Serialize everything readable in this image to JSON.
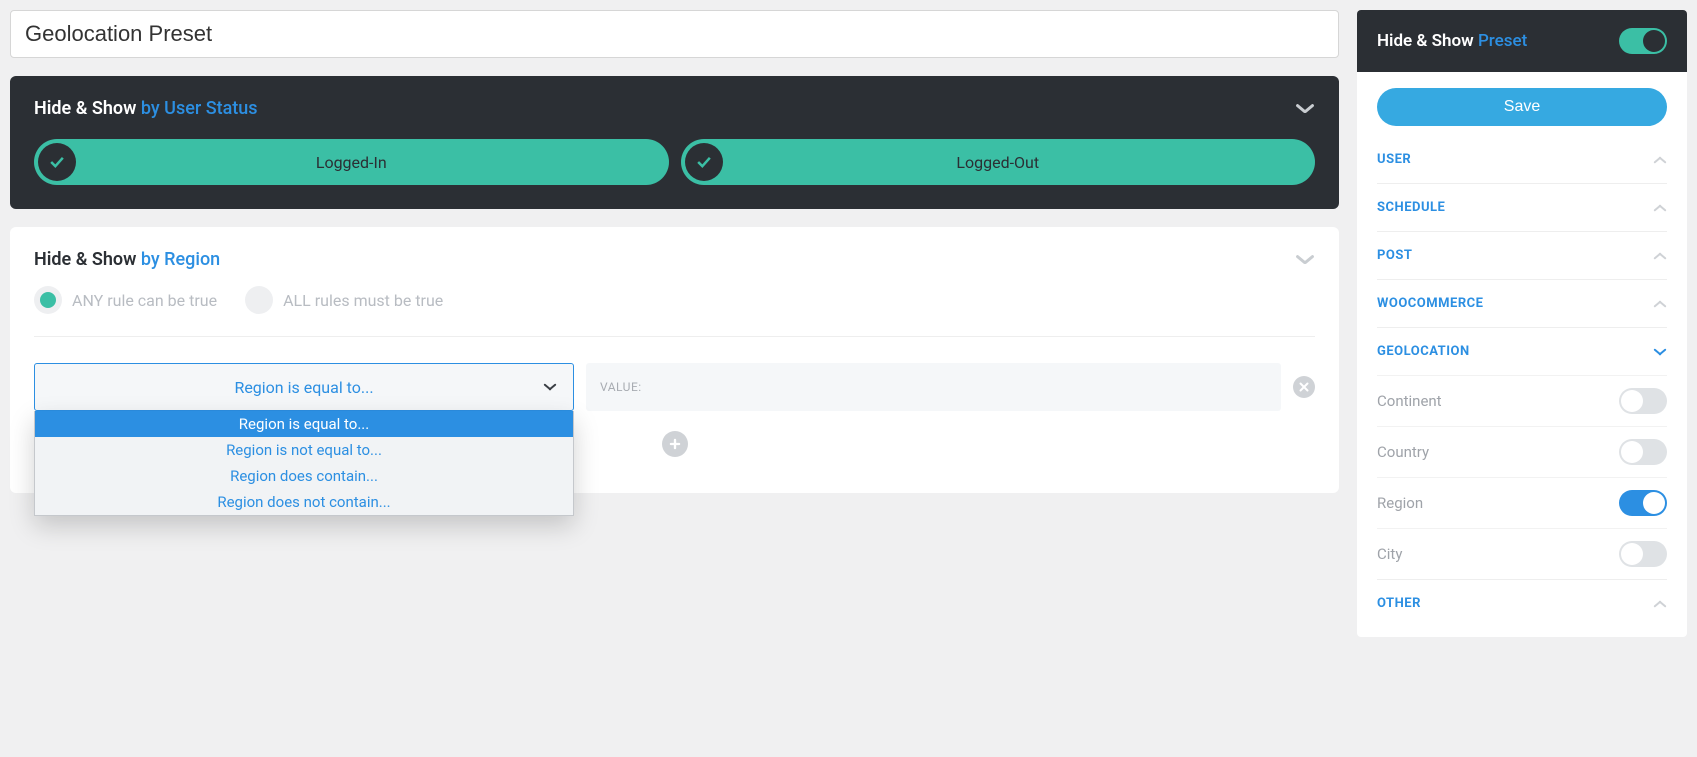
{
  "title_value": "Geolocation Preset",
  "userStatus": {
    "prefix": "Hide & Show",
    "suffix": "by User Status",
    "loggedIn": "Logged-In",
    "loggedOut": "Logged-Out"
  },
  "region": {
    "prefix": "Hide & Show",
    "suffix": "by Region",
    "anyRule": "ANY rule can be true",
    "allRule": "ALL rules must be true",
    "select_value": "Region is equal to...",
    "value_placeholder": "VALUE:",
    "options": [
      "Region is equal to...",
      "Region is not equal to...",
      "Region does contain...",
      "Region does not contain..."
    ]
  },
  "sidebar": {
    "heading_prefix": "Hide & Show",
    "heading_suffix": "Preset",
    "save": "Save",
    "sections": {
      "user": "USER",
      "schedule": "SCHEDULE",
      "post": "POST",
      "woocommerce": "WOOCOMMERCE",
      "geolocation": "GEOLOCATION",
      "other": "OTHER"
    },
    "geo_items": {
      "continent": "Continent",
      "country": "Country",
      "region": "Region",
      "city": "City"
    }
  }
}
